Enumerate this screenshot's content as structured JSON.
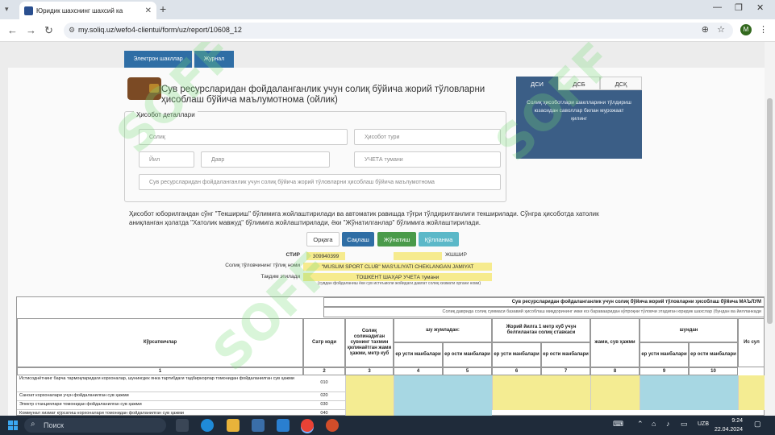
{
  "browser": {
    "tab_title": "Юридик шахснинг шахсий ка",
    "url": "my.soliq.uz/wefo4-clientui/form/uz/report/10608_12",
    "avatar_letter": "M",
    "icons": [
      "search-icon",
      "close-icon",
      "plus-icon",
      "back-icon",
      "forward-icon",
      "reload-icon",
      "zoom-icon",
      "star-icon",
      "kebab-icon"
    ]
  },
  "top_tabs": [
    "Электрон шакллар",
    "Журнал"
  ],
  "form": {
    "title": "Сув ресурсларидан фойдаланганлик учун солиқ бўйича жорий тўловларни ҳисоблаш бўйича маълумотнома (ойлик)",
    "details_legend": "Ҳисобот деталлари",
    "fields": {
      "soliq": "Солиқ",
      "hisobot_turi": "Ҳисобот тури",
      "yil": "Йил",
      "davr": "Давр",
      "ucheta": "УЧЕТА тумани",
      "report_name": "Сув ресурсларидан фойдаланганлик учун солиқ бўйича жорий тўловларни ҳисоблаш бўйича маълумотнома"
    }
  },
  "dsi": {
    "tabs": [
      "ДСИ",
      "ДСБ",
      "ДСҚ"
    ],
    "message": "Солиқ ҳисоботлари шаклларини тўлдириш юзасидан саволлар билан мурожаат қилинг"
  },
  "instructions": "Ҳисобот юборилгандан сўнг \"Текшириш\" бўлимига жойлаштирилади ва автоматик равишда тўғри тўлдирилганлиги текширилади. Сўнгра ҳисоботда хатолик аниқланган ҳолатда \"Хатолик мавжуд\" бўлимига жойлаштирилади, ёки \"Жўнатилганлар\" бўлимига жойлаштирилади.",
  "buttons": {
    "back": "Орқага",
    "save": "Сақлаш",
    "send": "Жўнатиш",
    "help": "Қўлланма"
  },
  "info": {
    "stir_label": "СТИР",
    "stir": "309940399",
    "pinfl_label": "ЖШШИР",
    "name_label": "Солиқ тўловчининг тўлиқ номи",
    "name": "\"MUSLIM SPORT CLUB\" MAS'ULIYATI CHEKLANGAN JAMIYAT",
    "district_label": "Тақдим этилади",
    "district": "ТОШКЕНТ ШАҲАР УЧЕТА тумани",
    "sub_note": "(сувдан фойдаланиш ёки сув истеъмоли жойидаги давлат солиқ хизмати органи номи)"
  },
  "table": {
    "title": "Сув ресурсларидан фойдаланганлик учун солиқ бўйича жорий тўловларни ҳисоблаш бўйича МАЪЛУМ",
    "subtitle": "Солиқ даврида солиқ суммаси базавий ҳисоблаш миқдорининг икки юз баравааридан кўпроқни тўловчи этадиган юридик шахслар (бундан ва йилланкади",
    "headers": {
      "indicators": "Кўрсаткичлар",
      "row_code": "Сатр коди",
      "water_volume": "Солиқ солинадиган сувнинг тахмин қилинаётган жами ҳажми, метр куб",
      "including": "шу жумладан:",
      "rate": "Жорий йилга 1 метр куб учун белгиланган солиқ ставкаси",
      "total": "жами, сув ҳажми",
      "of_which": "шундан",
      "surface": "ер усти манбалари",
      "underground": "ер ости манбалари",
      "more": "Ис сул"
    },
    "col_numbers": [
      "1",
      "2",
      "3",
      "4",
      "5",
      "6",
      "7",
      "8",
      "9",
      "10"
    ],
    "rows": [
      {
        "name": "Истисоднётнинг барча тармоқларидаги корхоналар, шунингдек янка тартибдаги тадбиркорлар томонидан фойдаланилган сув ҳажми",
        "code": "010"
      },
      {
        "name": "Саноат корхоналари учун фойдаланилган сув ҳажми",
        "code": "020"
      },
      {
        "name": "Электр станциялари томонидан фойдаланилган сув ҳажми",
        "code": "030"
      },
      {
        "name": "Коммунал хизмат кўрсатиш корхоналари томонидан фойдаланилган сув ҳажми",
        "code": "040"
      }
    ]
  },
  "taskbar": {
    "search": "Поиск",
    "lang": "UZB",
    "time": "9:24",
    "date": "22.04.2024"
  },
  "colors": {
    "blue": "#2f6ea5",
    "green": "#4a9a4a",
    "teal": "#5bb8c8",
    "yellow": "#f6eb8e",
    "dsi": "#3b5e86"
  },
  "watermark": "SOFF"
}
